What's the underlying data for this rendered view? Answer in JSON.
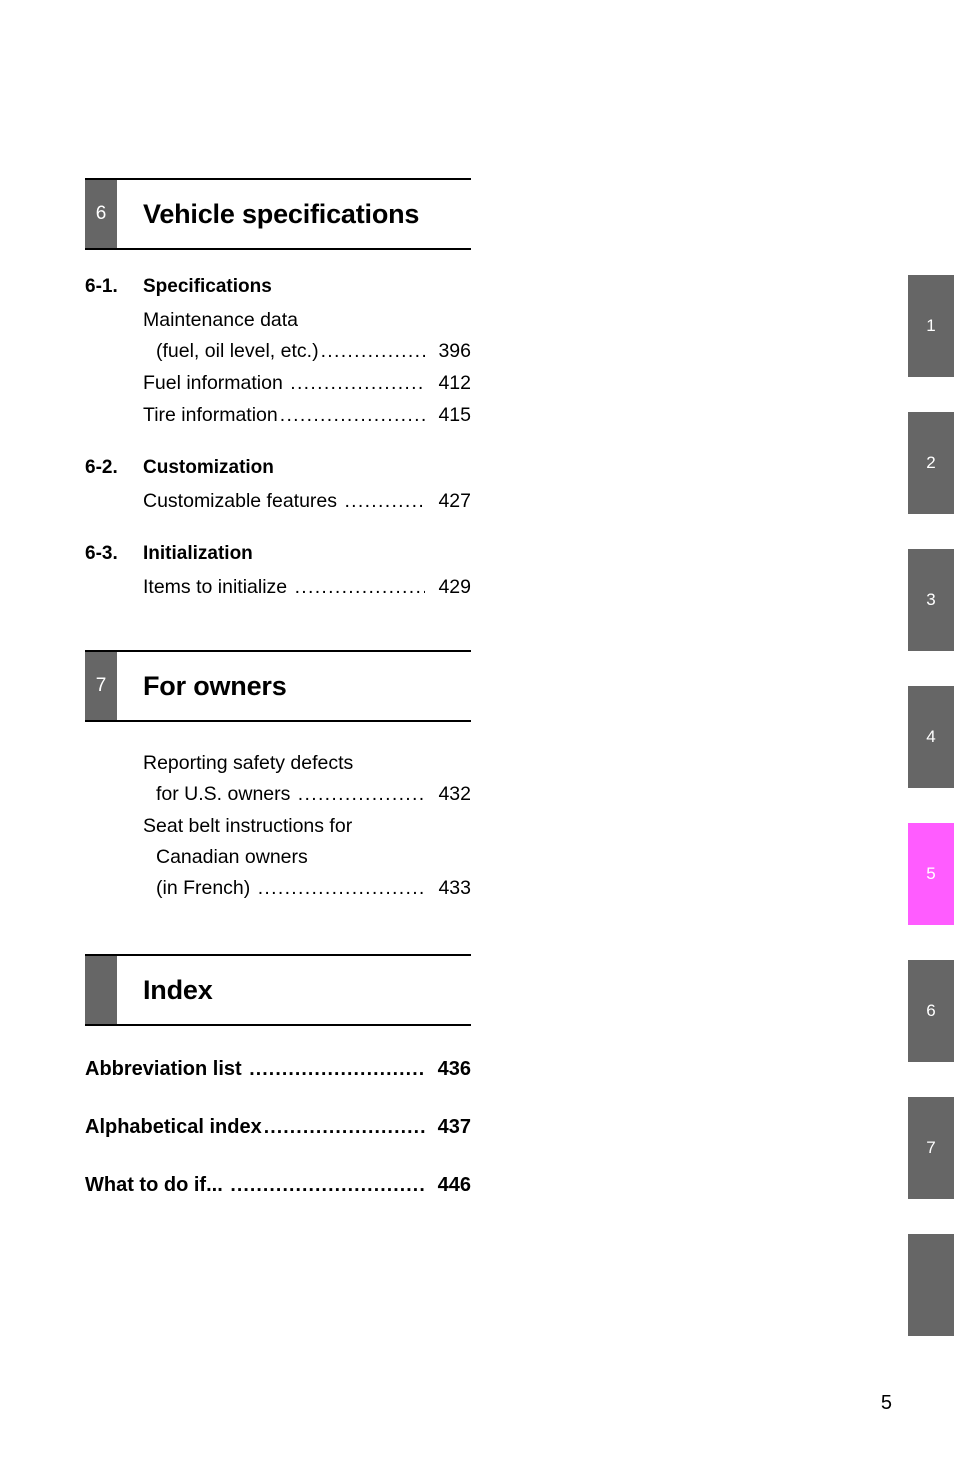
{
  "page": {
    "folio": "5"
  },
  "chapters": [
    {
      "number": "6",
      "title": "Vehicle specifications",
      "sections": [
        {
          "number": "6-1.",
          "label": "Specifications",
          "entries": [
            {
              "lines": [
                "Maintenance data"
              ],
              "last_line": "(fuel, oil level, etc.)",
              "page": "396"
            },
            {
              "lines": [],
              "last_line": "Fuel information ",
              "page": "412"
            },
            {
              "lines": [],
              "last_line": "Tire information",
              "page": "415"
            }
          ]
        },
        {
          "number": "6-2.",
          "label": "Customization",
          "entries": [
            {
              "lines": [],
              "last_line": "Customizable features ",
              "page": "427"
            }
          ]
        },
        {
          "number": "6-3.",
          "label": "Initialization",
          "entries": [
            {
              "lines": [],
              "last_line": "Items to initialize ",
              "page": "429"
            }
          ]
        }
      ]
    },
    {
      "number": "7",
      "title": "For owners",
      "sections": [
        {
          "number": "",
          "label": "",
          "entries": [
            {
              "lines": [
                "Reporting safety defects"
              ],
              "last_line": "for U.S. owners ",
              "page": "432"
            },
            {
              "lines": [
                "Seat belt instructions for",
                "Canadian owners"
              ],
              "last_line": "(in French) ",
              "page": "433"
            }
          ]
        }
      ]
    }
  ],
  "index_block": {
    "number": "",
    "title": "Index",
    "entries": [
      {
        "label": "Abbreviation list ",
        "page": "436"
      },
      {
        "label": "Alphabetical index",
        "page": "437"
      },
      {
        "label": "What to do if... ",
        "page": "446"
      }
    ]
  },
  "tab_rail": {
    "tabs": [
      {
        "label": "1",
        "active": false
      },
      {
        "label": "2",
        "active": false
      },
      {
        "label": "3",
        "active": false
      },
      {
        "label": "4",
        "active": false
      },
      {
        "label": "5",
        "active": true
      },
      {
        "label": "6",
        "active": false
      },
      {
        "label": "7",
        "active": false
      },
      {
        "label": "",
        "active": false
      }
    ],
    "active_color": "#ff5cff",
    "inactive_color": "#666666"
  },
  "leader_dots": ".........................................................."
}
